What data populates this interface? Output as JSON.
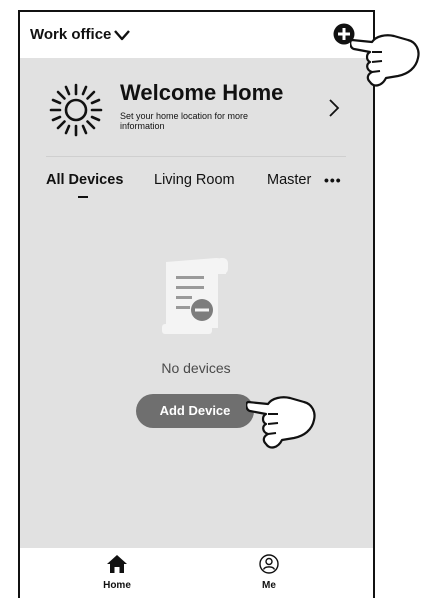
{
  "header": {
    "location_label": "Work office",
    "location_dropdown_icon": "chevron-down-icon",
    "add_icon": "plus-circle-icon"
  },
  "welcome": {
    "title": "Welcome Home",
    "subtitle": "Set your home location for more information",
    "icon": "sun-icon",
    "arrow_icon": "chevron-right-icon"
  },
  "tabs": {
    "items": [
      {
        "label": "All Devices",
        "active": true
      },
      {
        "label": "Living Room",
        "active": false
      },
      {
        "label": "Master",
        "active": false
      }
    ],
    "more_label": "•••"
  },
  "empty_state": {
    "icon": "no-devices-document-icon",
    "message": "No devices",
    "add_button_label": "Add Device"
  },
  "bottom_nav": {
    "items": [
      {
        "label": "Home",
        "icon": "home-icon",
        "active": true
      },
      {
        "label": "Me",
        "icon": "user-profile-icon",
        "active": false
      }
    ]
  },
  "annotations": {
    "pointer_icon": "pointing-hand-icon"
  },
  "colors": {
    "content_background": "#e1e1e1",
    "button_background": "#6f6f6f",
    "text_primary": "#111111"
  }
}
